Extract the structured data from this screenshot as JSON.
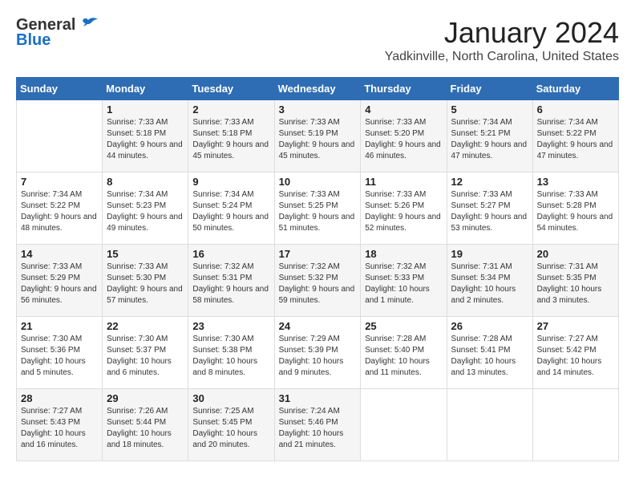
{
  "logo": {
    "general": "General",
    "blue": "Blue"
  },
  "header": {
    "month": "January 2024",
    "location": "Yadkinville, North Carolina, United States"
  },
  "weekdays": [
    "Sunday",
    "Monday",
    "Tuesday",
    "Wednesday",
    "Thursday",
    "Friday",
    "Saturday"
  ],
  "weeks": [
    [
      null,
      {
        "day": 1,
        "sunrise": "7:33 AM",
        "sunset": "5:18 PM",
        "daylight": "9 hours and 44 minutes."
      },
      {
        "day": 2,
        "sunrise": "7:33 AM",
        "sunset": "5:18 PM",
        "daylight": "9 hours and 45 minutes."
      },
      {
        "day": 3,
        "sunrise": "7:33 AM",
        "sunset": "5:19 PM",
        "daylight": "9 hours and 45 minutes."
      },
      {
        "day": 4,
        "sunrise": "7:33 AM",
        "sunset": "5:20 PM",
        "daylight": "9 hours and 46 minutes."
      },
      {
        "day": 5,
        "sunrise": "7:34 AM",
        "sunset": "5:21 PM",
        "daylight": "9 hours and 47 minutes."
      },
      {
        "day": 6,
        "sunrise": "7:34 AM",
        "sunset": "5:22 PM",
        "daylight": "9 hours and 47 minutes."
      }
    ],
    [
      {
        "day": 7,
        "sunrise": "7:34 AM",
        "sunset": "5:22 PM",
        "daylight": "9 hours and 48 minutes."
      },
      {
        "day": 8,
        "sunrise": "7:34 AM",
        "sunset": "5:23 PM",
        "daylight": "9 hours and 49 minutes."
      },
      {
        "day": 9,
        "sunrise": "7:34 AM",
        "sunset": "5:24 PM",
        "daylight": "9 hours and 50 minutes."
      },
      {
        "day": 10,
        "sunrise": "7:33 AM",
        "sunset": "5:25 PM",
        "daylight": "9 hours and 51 minutes."
      },
      {
        "day": 11,
        "sunrise": "7:33 AM",
        "sunset": "5:26 PM",
        "daylight": "9 hours and 52 minutes."
      },
      {
        "day": 12,
        "sunrise": "7:33 AM",
        "sunset": "5:27 PM",
        "daylight": "9 hours and 53 minutes."
      },
      {
        "day": 13,
        "sunrise": "7:33 AM",
        "sunset": "5:28 PM",
        "daylight": "9 hours and 54 minutes."
      }
    ],
    [
      {
        "day": 14,
        "sunrise": "7:33 AM",
        "sunset": "5:29 PM",
        "daylight": "9 hours and 56 minutes."
      },
      {
        "day": 15,
        "sunrise": "7:33 AM",
        "sunset": "5:30 PM",
        "daylight": "9 hours and 57 minutes."
      },
      {
        "day": 16,
        "sunrise": "7:32 AM",
        "sunset": "5:31 PM",
        "daylight": "9 hours and 58 minutes."
      },
      {
        "day": 17,
        "sunrise": "7:32 AM",
        "sunset": "5:32 PM",
        "daylight": "9 hours and 59 minutes."
      },
      {
        "day": 18,
        "sunrise": "7:32 AM",
        "sunset": "5:33 PM",
        "daylight": "10 hours and 1 minute."
      },
      {
        "day": 19,
        "sunrise": "7:31 AM",
        "sunset": "5:34 PM",
        "daylight": "10 hours and 2 minutes."
      },
      {
        "day": 20,
        "sunrise": "7:31 AM",
        "sunset": "5:35 PM",
        "daylight": "10 hours and 3 minutes."
      }
    ],
    [
      {
        "day": 21,
        "sunrise": "7:30 AM",
        "sunset": "5:36 PM",
        "daylight": "10 hours and 5 minutes."
      },
      {
        "day": 22,
        "sunrise": "7:30 AM",
        "sunset": "5:37 PM",
        "daylight": "10 hours and 6 minutes."
      },
      {
        "day": 23,
        "sunrise": "7:30 AM",
        "sunset": "5:38 PM",
        "daylight": "10 hours and 8 minutes."
      },
      {
        "day": 24,
        "sunrise": "7:29 AM",
        "sunset": "5:39 PM",
        "daylight": "10 hours and 9 minutes."
      },
      {
        "day": 25,
        "sunrise": "7:28 AM",
        "sunset": "5:40 PM",
        "daylight": "10 hours and 11 minutes."
      },
      {
        "day": 26,
        "sunrise": "7:28 AM",
        "sunset": "5:41 PM",
        "daylight": "10 hours and 13 minutes."
      },
      {
        "day": 27,
        "sunrise": "7:27 AM",
        "sunset": "5:42 PM",
        "daylight": "10 hours and 14 minutes."
      }
    ],
    [
      {
        "day": 28,
        "sunrise": "7:27 AM",
        "sunset": "5:43 PM",
        "daylight": "10 hours and 16 minutes."
      },
      {
        "day": 29,
        "sunrise": "7:26 AM",
        "sunset": "5:44 PM",
        "daylight": "10 hours and 18 minutes."
      },
      {
        "day": 30,
        "sunrise": "7:25 AM",
        "sunset": "5:45 PM",
        "daylight": "10 hours and 20 minutes."
      },
      {
        "day": 31,
        "sunrise": "7:24 AM",
        "sunset": "5:46 PM",
        "daylight": "10 hours and 21 minutes."
      },
      null,
      null,
      null
    ]
  ]
}
